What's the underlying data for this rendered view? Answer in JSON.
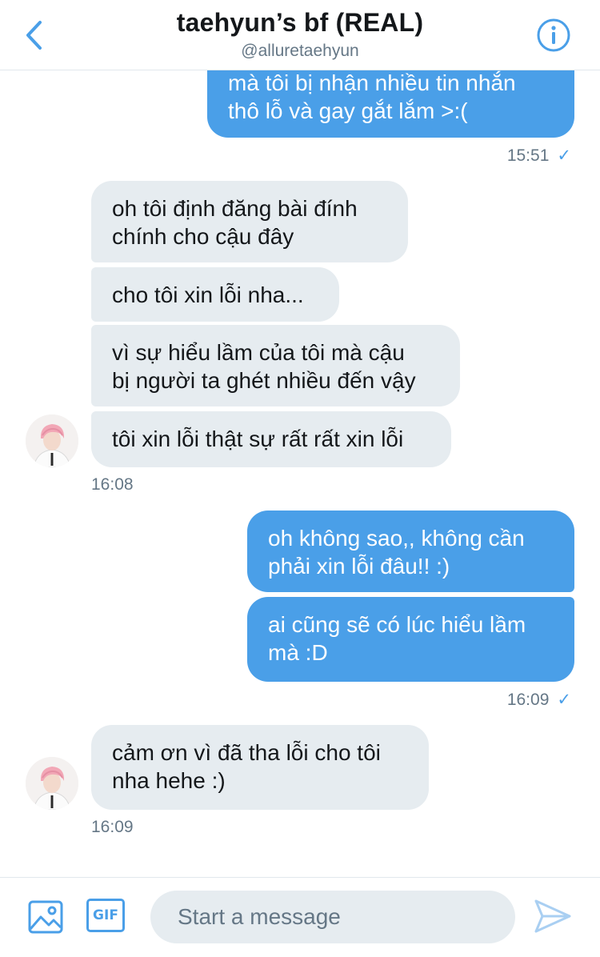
{
  "header": {
    "title": "taehyun’s bf (REAL)",
    "handle": "@alluretaehyun",
    "back_icon": "chevron-left-icon",
    "info_icon": "info-icon"
  },
  "conversation": {
    "messages": [
      {
        "direction": "outgoing",
        "lines": [
          "mà tôi bị nhận nhiều tin nhắn",
          "thô lỗ và gay gắt lắm >:("
        ]
      },
      {
        "direction": "incoming",
        "lines": [
          "oh tôi định đăng bài đính",
          "chính cho cậu đây"
        ]
      },
      {
        "direction": "incoming",
        "lines": [
          "cho tôi xin lỗi nha..."
        ]
      },
      {
        "direction": "incoming",
        "lines": [
          "vì sự hiểu lầm của tôi mà cậu",
          "bị người ta ghét nhiều đến vậy"
        ]
      },
      {
        "direction": "incoming",
        "lines": [
          "tôi xin lỗi thật sự rất rất xin lỗi"
        ]
      },
      {
        "direction": "outgoing",
        "lines": [
          "oh không sao,, không cần",
          "phải xin lỗi đâu!! :)"
        ]
      },
      {
        "direction": "outgoing",
        "lines": [
          "ai cũng sẽ có lúc hiểu lầm",
          "mà :D"
        ]
      },
      {
        "direction": "incoming",
        "lines": [
          "cảm ơn vì đã tha lỗi cho tôi",
          "nha hehe :)"
        ]
      }
    ],
    "timestamps": {
      "t1": "15:51",
      "t2": "16:08",
      "t3": "16:09",
      "t4": "16:09"
    },
    "read_check": "✓"
  },
  "composer": {
    "placeholder": "Start a message",
    "gif_label": "GIF",
    "media_icon": "image-icon",
    "send_icon": "send-icon"
  },
  "colors": {
    "accent": "#4a9fe8",
    "incoming_bubble": "#e6ecf0",
    "muted_text": "#657786"
  }
}
